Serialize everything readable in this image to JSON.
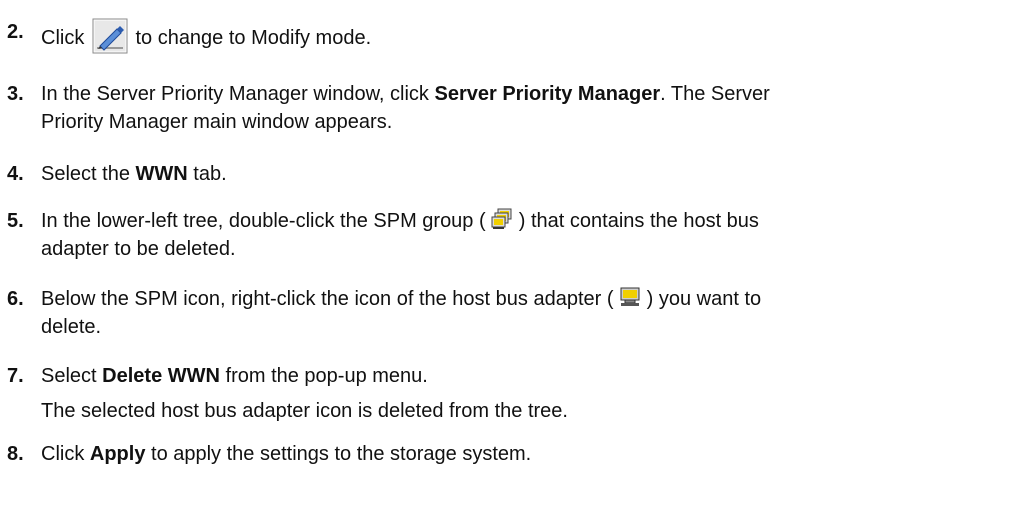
{
  "steps": [
    {
      "num": "2.",
      "pre": "Click ",
      "icon": "modify-mode-button-icon",
      "post": " to change to Modify mode."
    },
    {
      "num": "3.",
      "pre": "In the Server Priority Manager window, click ",
      "bold": "Server Priority Manager",
      "post": ". The Server",
      "line2": "Priority Manager main window appears."
    },
    {
      "num": "4.",
      "pre": "Select the ",
      "bold": "WWN",
      "post": " tab."
    },
    {
      "num": "5.",
      "pre": "In the lower-left tree, double-click the SPM group ( ",
      "icon": "spm-group-icon",
      "post": " ) that contains the host bus",
      "line2": "adapter to be deleted."
    },
    {
      "num": "6.",
      "pre": "Below the SPM icon, right-click the icon of the host bus adapter ( ",
      "icon": "host-bus-adapter-icon",
      "post": " ) you want to",
      "line2": "delete."
    },
    {
      "num": "7.",
      "pre": "Select ",
      "bold": "Delete WWN",
      "post": " from the pop-up menu.",
      "line2": "The selected host bus adapter icon is deleted from the tree."
    },
    {
      "num": "8.",
      "pre": "Click ",
      "bold": "Apply",
      "post": " to apply the settings to the storage system."
    }
  ]
}
